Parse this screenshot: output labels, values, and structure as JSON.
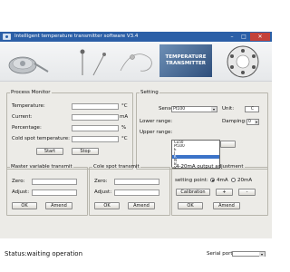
{
  "title": "Intelligent temperature transmitter software V3.4",
  "banner": {
    "line1": "TEMPERATURE",
    "line2": "TRANSMITTER"
  },
  "process_monitor": {
    "legend": "Process Monitor",
    "temperature_label": "Temperature:",
    "temperature_unit": "°C",
    "current_label": "Current:",
    "current_unit": "mA",
    "percentage_label": "Percentage:",
    "percentage_unit": "%",
    "cold_spot_label": "Cold spot temperature:",
    "cold_spot_unit": "°C",
    "start": "Start",
    "stop": "Stop"
  },
  "setting": {
    "legend": "Setting",
    "sensor_label": "Sensor:",
    "sensor_value": "Pt100",
    "unit_label": "Unit:",
    "unit_value": "C",
    "lower_label": "Lower range:",
    "upper_label": "Upper range:",
    "damping_label": "Damping:",
    "damping_value": "0",
    "options": [
      "Cu50",
      "Pt100",
      "E",
      "J",
      "K",
      "N",
      "B",
      "S"
    ],
    "selected_option": "K"
  },
  "master": {
    "legend": "Master variable transmit",
    "zero": "Zero:",
    "adjust": "Adjust:",
    "ok": "OK",
    "amend": "Amend"
  },
  "cold": {
    "legend": "Cole spot transmit",
    "zero": "Zero:",
    "adjust": "Adjust:",
    "ok": "OK",
    "amend": "Amend"
  },
  "output": {
    "legend": "4-20mA output adjustment",
    "setting_point": "setting point:",
    "opt_4ma": "4mA",
    "opt_20ma": "20mA",
    "calibration": "Calibration",
    "plus": "+",
    "minus": "-",
    "ok": "OK",
    "amend": "Amend"
  },
  "statusbar": {
    "status": "Status:waiting operation",
    "serial_label": "Serial port:"
  }
}
